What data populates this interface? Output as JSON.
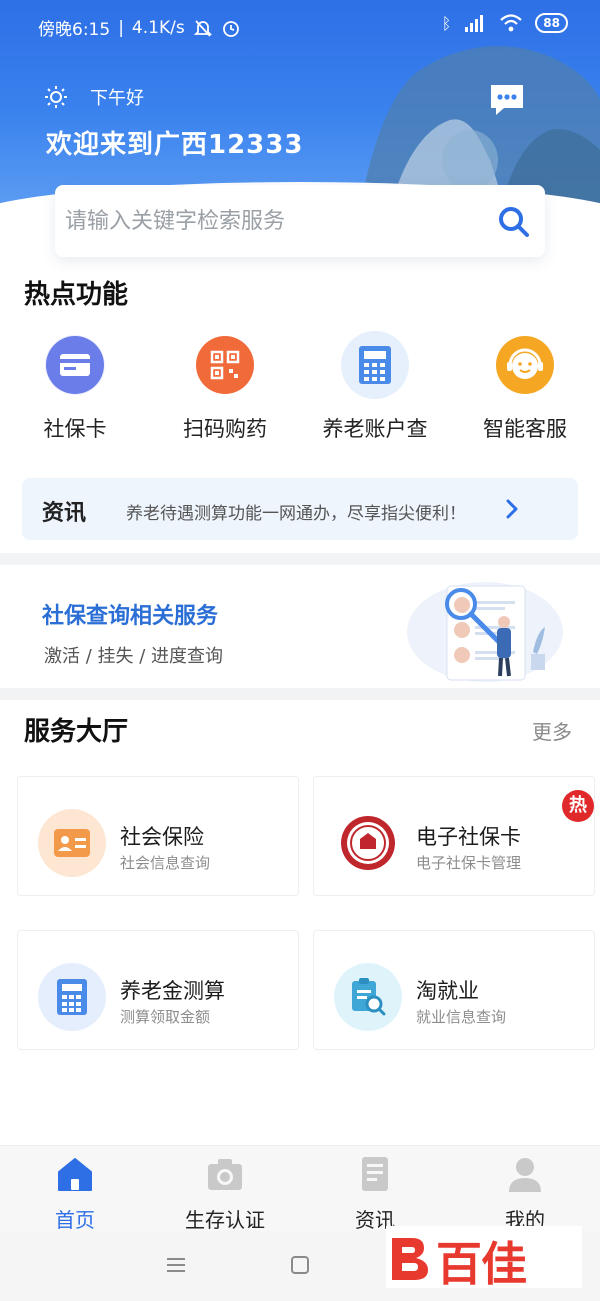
{
  "status_bar": {
    "time": "傍晚6:15",
    "speed": "4.1K/s",
    "battery": "88",
    "icons": [
      "alarm-off-icon",
      "alarm-icon",
      "bluetooth-icon",
      "signal-hd-icon",
      "wifi-icon",
      "battery-icon"
    ]
  },
  "header": {
    "greeting": "下午好",
    "welcome": "欢迎来到广西12333",
    "message_icon": "message-icon",
    "brand_color": "#2e6fe6"
  },
  "search": {
    "placeholder": "请输入关键字检索服务"
  },
  "hot_functions": {
    "title": "热点功能",
    "items": [
      {
        "label": "社保卡",
        "icon": "social-security-card-icon",
        "color": "#6b7de9"
      },
      {
        "label": "扫码购药",
        "icon": "qr-code-icon",
        "color": "#f06a3a"
      },
      {
        "label": "养老账户查",
        "icon": "calculator-icon",
        "color": "#4a8ae8"
      },
      {
        "label": "智能客服",
        "icon": "customer-service-icon",
        "color": "#f5a623"
      }
    ]
  },
  "news": {
    "tag": "资讯",
    "text": "养老待遇测算功能一网通办，尽享指尖便利！"
  },
  "banner": {
    "title": "社保查询相关服务",
    "subtitle": "激活 / 挂失 / 进度查询"
  },
  "service_hall": {
    "title": "服务大厅",
    "more": "更多",
    "hot_badge": "热",
    "cards": [
      {
        "title": "社会保险",
        "subtitle": "社会信息查询",
        "icon": "id-card-icon"
      },
      {
        "title": "电子社保卡",
        "subtitle": "电子社保卡管理",
        "icon": "social-security-emblem-icon"
      },
      {
        "title": "养老金测算",
        "subtitle": "测算领取金额",
        "icon": "calculator-icon"
      },
      {
        "title": "淘就业",
        "subtitle": "就业信息查询",
        "icon": "job-search-icon"
      }
    ]
  },
  "tab_bar": {
    "tabs": [
      {
        "label": "首页",
        "icon": "home-icon",
        "active": true
      },
      {
        "label": "生存认证",
        "icon": "camera-icon",
        "active": false
      },
      {
        "label": "资讯",
        "icon": "news-icon",
        "active": false
      },
      {
        "label": "我的",
        "icon": "profile-icon",
        "active": false
      }
    ]
  },
  "watermark": {
    "text": "百佳"
  }
}
